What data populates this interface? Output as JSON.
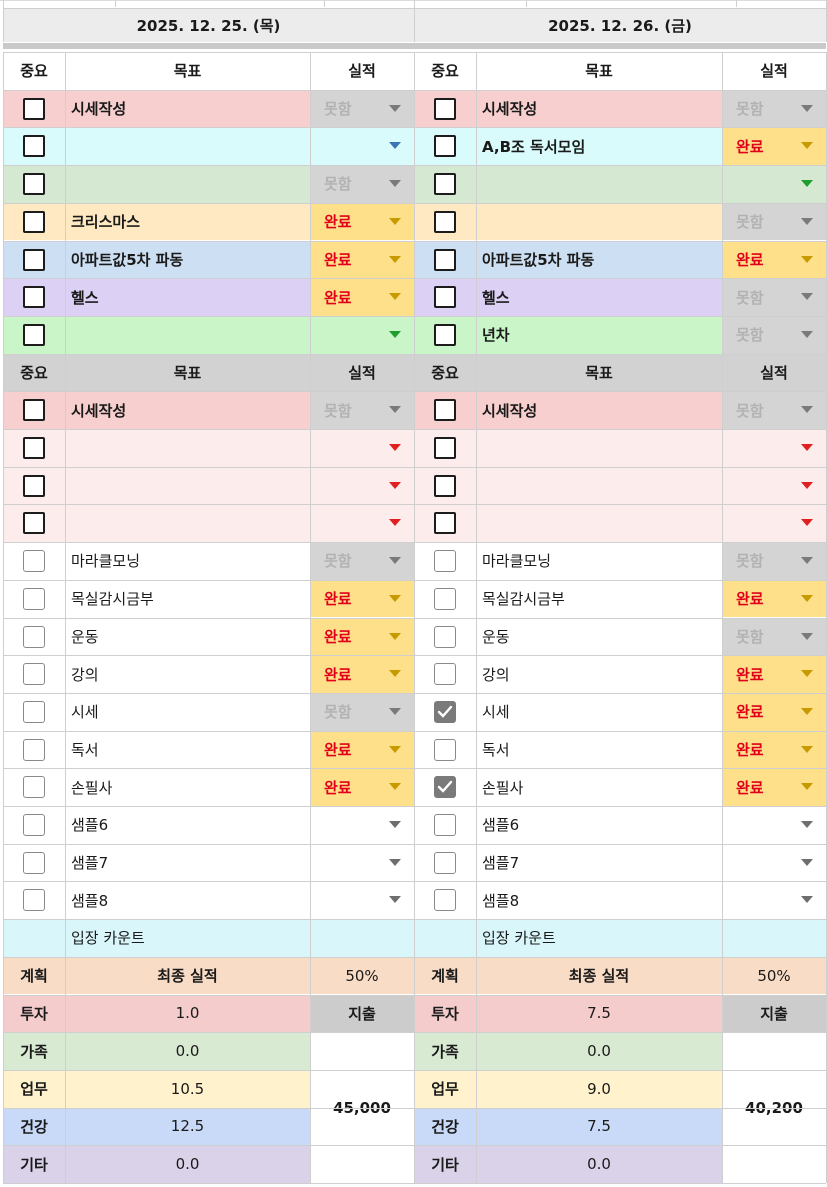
{
  "days": [
    {
      "date": "2025. 12. 25. (목)",
      "top_header": {
        "importance": "중요",
        "goal": "목표",
        "result": "실적"
      },
      "top_rows": [
        {
          "goal": "시세작성",
          "result": "못함",
          "bg": "#f8cfcf"
        },
        {
          "goal": "",
          "result": "",
          "bg": "#d9fbfb",
          "arrow": "#3b74b8"
        },
        {
          "goal": "",
          "result": "못함",
          "bg": "#d5e9d2"
        },
        {
          "goal": "크리스마스",
          "result": "완료",
          "bg": "#ffe9c2"
        },
        {
          "goal": "아파트값5차 파동",
          "result": "완료",
          "bg": "#cddff2"
        },
        {
          "goal": "헬스",
          "result": "완료",
          "bg": "#dcd1f5"
        },
        {
          "goal": "",
          "result": "",
          "bg": "#c9f5c9",
          "arrow": "#1f9e2f"
        }
      ],
      "mid_header": {
        "importance": "중요",
        "goal": "목표",
        "result": "실적"
      },
      "mid_rows": [
        {
          "goal": "시세작성",
          "result": "못함",
          "bg": "#f8cfcf"
        },
        {
          "goal": "",
          "result": "",
          "bg": "#fdecec",
          "arrow": "#e02020"
        },
        {
          "goal": "",
          "result": "",
          "bg": "#fdecec",
          "arrow": "#e02020"
        },
        {
          "goal": "",
          "result": "",
          "bg": "#fdecec",
          "arrow": "#e02020"
        }
      ],
      "routine_rows": [
        {
          "goal": "마라클모닝",
          "result": "못함",
          "checked": false
        },
        {
          "goal": "목실감시금부",
          "result": "완료",
          "checked": false
        },
        {
          "goal": "운동",
          "result": "완료",
          "checked": false
        },
        {
          "goal": "강의",
          "result": "완료",
          "checked": false
        },
        {
          "goal": "시세",
          "result": "못함",
          "checked": false
        },
        {
          "goal": "독서",
          "result": "완료",
          "checked": false
        },
        {
          "goal": "손필사",
          "result": "완료",
          "checked": false
        },
        {
          "goal": "샘플6",
          "result": "",
          "checked": false
        },
        {
          "goal": "샘플7",
          "result": "",
          "checked": false
        },
        {
          "goal": "샘플8",
          "result": "",
          "checked": false
        }
      ],
      "entry_count_label": "입장 카운트",
      "summary": {
        "plan_label": "계획",
        "final_label": "최종 실적",
        "final_value": "50%",
        "spend_label": "지출",
        "spend_value": "45,000",
        "categories": [
          {
            "label": "투자",
            "value": "1.0"
          },
          {
            "label": "가족",
            "value": "0.0"
          },
          {
            "label": "업무",
            "value": "10.5"
          },
          {
            "label": "건강",
            "value": "12.5"
          },
          {
            "label": "기타",
            "value": "0.0"
          }
        ]
      }
    },
    {
      "date": "2025. 12. 26. (금)",
      "top_header": {
        "importance": "중요",
        "goal": "목표",
        "result": "실적"
      },
      "top_rows": [
        {
          "goal": "시세작성",
          "result": "못함",
          "bg": "#f8cfcf"
        },
        {
          "goal": "A,B조 독서모임",
          "result": "완료",
          "bg": "#d9fbfb"
        },
        {
          "goal": "",
          "result": "",
          "bg": "#d5e9d2",
          "arrow": "#1f9e2f"
        },
        {
          "goal": "",
          "result": "못함",
          "bg": "#ffe9c2"
        },
        {
          "goal": "아파트값5차 파동",
          "result": "완료",
          "bg": "#cddff2"
        },
        {
          "goal": "헬스",
          "result": "못함",
          "bg": "#dcd1f5"
        },
        {
          "goal": "년차",
          "result": "못함",
          "bg": "#c9f5c9"
        }
      ],
      "mid_header": {
        "importance": "중요",
        "goal": "목표",
        "result": "실적"
      },
      "mid_rows": [
        {
          "goal": "시세작성",
          "result": "못함",
          "bg": "#f8cfcf"
        },
        {
          "goal": "",
          "result": "",
          "bg": "#fdecec",
          "arrow": "#e02020"
        },
        {
          "goal": "",
          "result": "",
          "bg": "#fdecec",
          "arrow": "#e02020"
        },
        {
          "goal": "",
          "result": "",
          "bg": "#fdecec",
          "arrow": "#e02020"
        }
      ],
      "routine_rows": [
        {
          "goal": "마라클모닝",
          "result": "못함",
          "checked": false
        },
        {
          "goal": "목실감시금부",
          "result": "완료",
          "checked": false
        },
        {
          "goal": "운동",
          "result": "못함",
          "checked": false
        },
        {
          "goal": "강의",
          "result": "완료",
          "checked": false
        },
        {
          "goal": "시세",
          "result": "완료",
          "checked": true
        },
        {
          "goal": "독서",
          "result": "완료",
          "checked": false
        },
        {
          "goal": "손필사",
          "result": "완료",
          "checked": true
        },
        {
          "goal": "샘플6",
          "result": "",
          "checked": false
        },
        {
          "goal": "샘플7",
          "result": "",
          "checked": false
        },
        {
          "goal": "샘플8",
          "result": "",
          "checked": false
        }
      ],
      "entry_count_label": "입장 카운트",
      "summary": {
        "plan_label": "계획",
        "final_label": "최종 실적",
        "final_value": "50%",
        "spend_label": "지출",
        "spend_value": "40,200",
        "categories": [
          {
            "label": "투자",
            "value": "7.5"
          },
          {
            "label": "가족",
            "value": "0.0"
          },
          {
            "label": "업무",
            "value": "9.0"
          },
          {
            "label": "건강",
            "value": "7.5"
          },
          {
            "label": "기타",
            "value": "0.0"
          }
        ]
      }
    }
  ],
  "colors": {
    "header_gray": "#d2d2d2",
    "fail_gray_bg": "#d4d4d4",
    "done_yellow_bg": "#ffe08a",
    "done_red_text": "#e0001a",
    "fail_gray_text": "#b2b2b2",
    "entry_count_bg": "#d9f6fb",
    "summary_header_bg": "#f9dcc6",
    "invest_bg": "#f4cccc",
    "family_bg": "#d9ead3",
    "work_bg": "#fff2cc",
    "health_bg": "#c9daf8",
    "other_bg": "#d9d2e9",
    "spend_bg": "#cccccc"
  }
}
